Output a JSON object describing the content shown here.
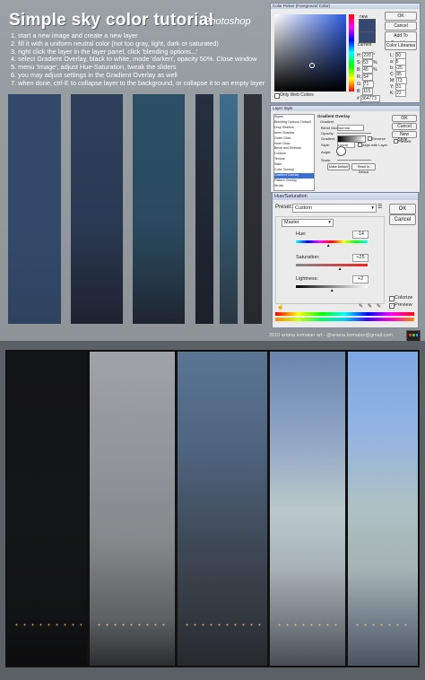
{
  "title": "Simple sky color tutorial",
  "subtitle": "Photoshop",
  "steps": [
    "1. start a new image and create a new layer",
    "2. fill it with a uniform neutral color (not too gray, light, dark or saturated)",
    "3. right click the layer in the layer panel, click 'blending options...'",
    "4. select Gradient Overlay, black to white, mode 'darken', opacity 50%. Close window",
    "5. menu 'Image', adjust Hue-Saturation, tweak the sliders",
    "6. you may adjust settings in the Gradient Overlay as well",
    "7. when done, ctrl-E to collapse layer to the background, or collapse it to an empty layer"
  ],
  "strip_colors": [
    "#33496b",
    "#2d3f5a",
    "#2b4f66",
    "#252f3f",
    "#3e6e8c",
    "#2f3236"
  ],
  "color_picker": {
    "window_title": "Color Picker (Foreground Color)",
    "ok": "OK",
    "cancel": "Cancel",
    "add_to_swatches": "Add To Swatches",
    "color_libraries": "Color Libraries",
    "new_label": "new",
    "current_label": "current",
    "only_web_colors": "Only Web Colors",
    "fields": [
      {
        "label": "H:",
        "value": "220",
        "unit": "°"
      },
      {
        "label": "S:",
        "value": "53",
        "unit": "%"
      },
      {
        "label": "B:",
        "value": "45",
        "unit": "%"
      },
      {
        "label": "R:",
        "value": "54",
        "unit": ""
      },
      {
        "label": "G:",
        "value": "71",
        "unit": ""
      },
      {
        "label": "B:",
        "value": "115",
        "unit": ""
      }
    ],
    "lab_fields": [
      {
        "label": "L:",
        "value": "30"
      },
      {
        "label": "a:",
        "value": "5"
      },
      {
        "label": "b:",
        "value": "-25"
      },
      {
        "label": "C:",
        "value": "85"
      },
      {
        "label": "M:",
        "value": "73"
      },
      {
        "label": "Y:",
        "value": "31"
      },
      {
        "label": "K:",
        "value": "22"
      }
    ],
    "hex_label": "#",
    "hex": "364773"
  },
  "layer_style": {
    "window_title": "Layer Style",
    "styles_list": [
      "Styles",
      "Blending Options: Default",
      "Drop Shadow",
      "Inner Shadow",
      "Outer Glow",
      "Inner Glow",
      "Bevel and Emboss",
      "Contour",
      "Texture",
      "Satin",
      "Color Overlay",
      "Gradient Overlay",
      "Pattern Overlay",
      "Stroke"
    ],
    "section_title": "Gradient Overlay",
    "sub_title": "Gradient",
    "blend_mode_label": "Blend Mode:",
    "blend_mode": "Normal",
    "opacity_label": "Opacity:",
    "gradient_label": "Gradient:",
    "reverse_label": "Reverse",
    "style_label": "Style:",
    "style_value": "Linear",
    "align_label": "Align with Layer",
    "angle_label": "Angle:",
    "scale_label": "Scale:",
    "make_default": "Make Default",
    "reset_default": "Reset to Default",
    "ok": "OK",
    "cancel": "Cancel",
    "new_style": "New Style...",
    "preview_label": "Preview"
  },
  "hue_saturation": {
    "window_title": "Hue/Saturation",
    "preset_label": "Preset:",
    "preset_value": "Custom",
    "ok": "OK",
    "cancel": "Cancel",
    "channel": "Master",
    "hue_label": "Hue:",
    "hue_value": "-14",
    "saturation_label": "Saturation:",
    "saturation_value": "+25",
    "lightness_label": "Lightness:",
    "lightness_value": "+2",
    "colorize_label": "Colorize",
    "preview_label": "Preview",
    "hue_level": 0.46,
    "saturation_level": 0.62,
    "lightness_level": 0.51
  },
  "credit": "2010 ariana komalan art - @ariana.komalan@gmail.com",
  "panels": [
    {
      "top": "#131416",
      "mid": "#151617",
      "bottom": "#0c0c0d"
    },
    {
      "top": "#9fa3a7",
      "mid": "#85898c",
      "bottom": "#2c2d30"
    },
    {
      "top": "#5a7595",
      "mid": "#3f4a57",
      "bottom": "#26282c"
    },
    {
      "top": "#6a86ad",
      "mid": "#b9c8cc",
      "bottom": "#4a4e55"
    },
    {
      "top": "#7fa7e2",
      "mid": "#aec1c2",
      "bottom": "#4b5560"
    }
  ]
}
